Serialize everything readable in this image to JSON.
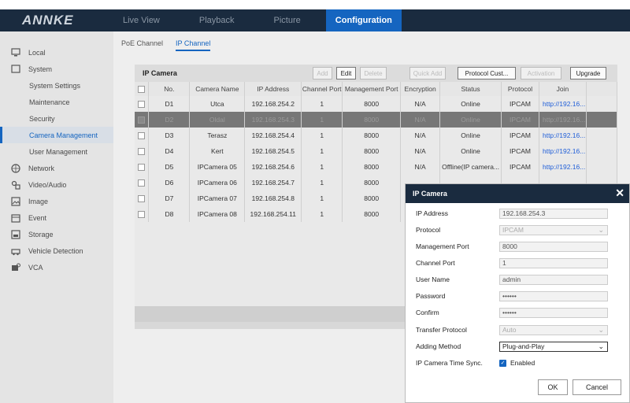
{
  "brand": "ANNKE",
  "nav": [
    "Live View",
    "Playback",
    "Picture",
    "Configuration"
  ],
  "sidebar": [
    {
      "label": "Local",
      "icon": "monitor-icon",
      "sub": false
    },
    {
      "label": "System",
      "icon": "system-icon",
      "sub": false
    },
    {
      "label": "System Settings",
      "sub": true
    },
    {
      "label": "Maintenance",
      "sub": true
    },
    {
      "label": "Security",
      "sub": true
    },
    {
      "label": "Camera Management",
      "sub": true,
      "active": true
    },
    {
      "label": "User Management",
      "sub": true
    },
    {
      "label": "Network",
      "icon": "globe-icon",
      "sub": false
    },
    {
      "label": "Video/Audio",
      "icon": "video-audio-icon",
      "sub": false
    },
    {
      "label": "Image",
      "icon": "image-icon",
      "sub": false
    },
    {
      "label": "Event",
      "icon": "calendar-icon",
      "sub": false
    },
    {
      "label": "Storage",
      "icon": "storage-icon",
      "sub": false
    },
    {
      "label": "Vehicle Detection",
      "icon": "vehicle-detection-icon",
      "sub": false
    },
    {
      "label": "VCA",
      "icon": "vca-icon",
      "sub": false
    }
  ],
  "tabs": [
    "PoE Channel",
    "IP Channel"
  ],
  "table": {
    "title": "IP Camera",
    "buttons": {
      "add": "Add",
      "edit": "Edit",
      "delete": "Delete",
      "quick_add": "Quick Add",
      "protocol": "Protocol Cust...",
      "activation": "Activation",
      "upgrade": "Upgrade"
    },
    "columns": [
      "No.",
      "Camera Name",
      "IP Address",
      "Channel Port",
      "Management Port",
      "Encryption",
      "Status",
      "Protocol",
      "Join"
    ],
    "rows": [
      {
        "no": "D1",
        "name": "Utca",
        "ip": "192.168.254.2",
        "ch": "1",
        "mp": "8000",
        "enc": "N/A",
        "status": "Online",
        "proto": "IPCAM",
        "join": "http://192.16..."
      },
      {
        "no": "D2",
        "name": "Oldal",
        "ip": "192.168.254.3",
        "ch": "1",
        "mp": "8000",
        "enc": "N/A",
        "status": "Online",
        "proto": "IPCAM",
        "join": "http://192.16..."
      },
      {
        "no": "D3",
        "name": "Terasz",
        "ip": "192.168.254.4",
        "ch": "1",
        "mp": "8000",
        "enc": "N/A",
        "status": "Online",
        "proto": "IPCAM",
        "join": "http://192.16..."
      },
      {
        "no": "D4",
        "name": "Kert",
        "ip": "192.168.254.5",
        "ch": "1",
        "mp": "8000",
        "enc": "N/A",
        "status": "Online",
        "proto": "IPCAM",
        "join": "http://192.16..."
      },
      {
        "no": "D5",
        "name": "IPCamera 05",
        "ip": "192.168.254.6",
        "ch": "1",
        "mp": "8000",
        "enc": "N/A",
        "status": "Offline(IP camera...",
        "proto": "IPCAM",
        "join": "http://192.16..."
      },
      {
        "no": "D6",
        "name": "IPCamera 06",
        "ip": "192.168.254.7",
        "ch": "1",
        "mp": "8000",
        "enc": "",
        "status": "",
        "proto": "",
        "join": ""
      },
      {
        "no": "D7",
        "name": "IPCamera 07",
        "ip": "192.168.254.8",
        "ch": "1",
        "mp": "8000",
        "enc": "",
        "status": "",
        "proto": "",
        "join": ""
      },
      {
        "no": "D8",
        "name": "IPCamera 08",
        "ip": "192.168.254.11",
        "ch": "1",
        "mp": "8000",
        "enc": "",
        "status": "",
        "proto": "",
        "join": ""
      }
    ]
  },
  "dialog": {
    "title": "IP Camera",
    "fields": [
      {
        "label": "IP Address",
        "value": "192.168.254.3",
        "kind": "text"
      },
      {
        "label": "Protocol",
        "value": "IPCAM",
        "kind": "select-disabled"
      },
      {
        "label": "Management Port",
        "value": "8000",
        "kind": "text"
      },
      {
        "label": "Channel Port",
        "value": "1",
        "kind": "text"
      },
      {
        "label": "User Name",
        "value": "admin",
        "kind": "text"
      },
      {
        "label": "Password",
        "value": "••••••",
        "kind": "password"
      },
      {
        "label": "Confirm",
        "value": "••••••",
        "kind": "password"
      },
      {
        "label": "Transfer Protocol",
        "value": "Auto",
        "kind": "select-disabled"
      },
      {
        "label": "Adding Method",
        "value": "Plug-and-Play",
        "kind": "select-active"
      }
    ],
    "sync_label": "IP Camera Time Sync.",
    "sync_value": "Enabled",
    "ok": "OK",
    "cancel": "Cancel"
  },
  "colors": {
    "accent": "#1565c0",
    "header": "#1a2b3f",
    "link": "#1f5ed8"
  }
}
